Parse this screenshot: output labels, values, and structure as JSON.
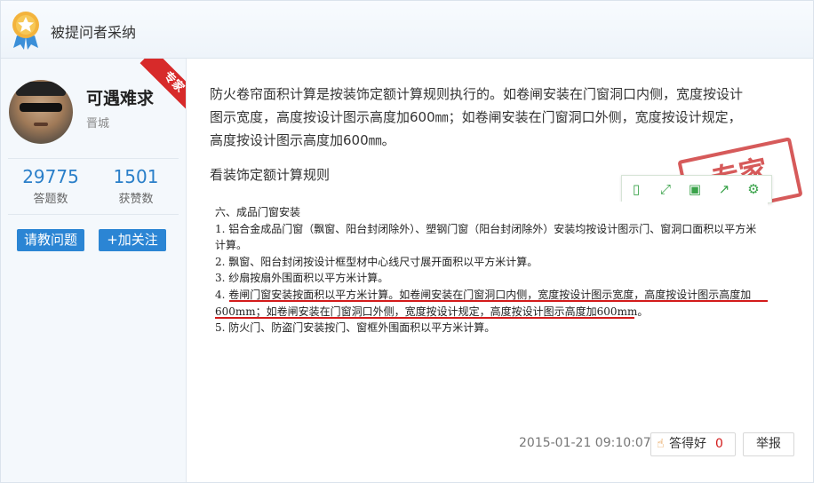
{
  "header": {
    "title": "被提问者采纳"
  },
  "profile": {
    "name": "可遇难求",
    "city": "晋城",
    "badge": "专家",
    "stats": [
      {
        "value": "29775",
        "label": "答题数"
      },
      {
        "value": "1501",
        "label": "获赞数"
      }
    ],
    "ask_button": "请教问题",
    "follow_button": "+加关注"
  },
  "answer": {
    "paragraph_lines": [
      "防火卷帘面积计算是按装饰定额计算规则执行的。如卷闸安装在门窗洞口内侧，宽度按设计",
      "图示宽度，高度按设计图示高度加600㎜；如卷闸安装在门窗洞口外侧，宽度按设计规定，",
      "高度按设计图示高度加600㎜。"
    ],
    "subheading": "看装饰定额计算规则",
    "stamp_text": "专家",
    "document_lines": [
      "六、成品门窗安装",
      "1. 铝合金成品门窗（飘窗、阳台封闭除外）、塑钢门窗（阳台封闭除外）安装均按设计图示门、窗洞口面积以平方米",
      "计算。",
      "2. 飘窗、阳台封闭按设计框型材中心线尺寸展开面积以平方米计算。",
      "3. 纱扇按扇外围面积以平方米计算。",
      "4. 卷闸门窗安装按面积以平方米计算。如卷闸安装在门窗洞口内侧，宽度按设计图示宽度，高度按设计图示高度加",
      "600mm；如卷闸安装在门窗洞口外侧，宽度按设计规定，高度按设计图示高度加600mm。",
      "5. 防火门、防盗门安装按门、窗框外围面积以平方米计算。"
    ]
  },
  "toolbar_icons": [
    "phone-icon",
    "fullscreen-icon",
    "save-icon",
    "share-icon",
    "settings-icon"
  ],
  "footer": {
    "timestamp": "2015-01-21 09:10:07",
    "like_label": "答得好",
    "like_count": "0",
    "report_label": "举报"
  },
  "colors": {
    "accent": "#2b85d4",
    "badge": "#d72a2a",
    "tool": "#3aa34a"
  }
}
